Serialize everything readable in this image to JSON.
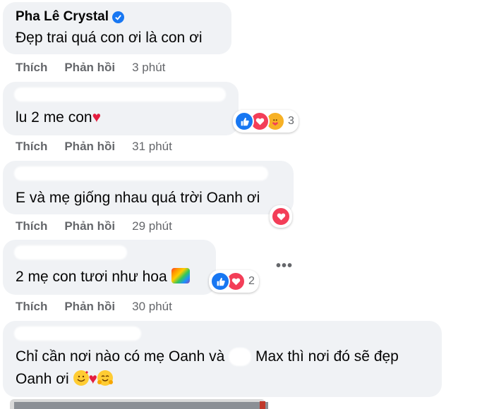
{
  "comments": [
    {
      "author": "Pha Lê Crystal",
      "text": "Đẹp trai quá con ơi là con ơi",
      "actions": {
        "like": "Thích",
        "reply": "Phản hồi",
        "time": "3 phút"
      }
    },
    {
      "text": "lu 2 me con",
      "actions": {
        "like": "Thích",
        "reply": "Phản hồi",
        "time": "31 phút"
      },
      "reactions": {
        "icons": [
          "like-icon",
          "love-icon",
          "care-icon"
        ],
        "count": "3"
      }
    },
    {
      "text": "E và mẹ giống nhau quá trời Oanh ơi",
      "actions": {
        "like": "Thích",
        "reply": "Phản hồi",
        "time": "29 phút"
      },
      "reactions": {
        "icons": [
          "love-icon"
        ]
      }
    },
    {
      "text": "2 mẹ con tươi như hoa",
      "actions": {
        "like": "Thích",
        "reply": "Phản hồi",
        "time": "30 phút"
      },
      "reactions": {
        "icons": [
          "like-icon",
          "love-icon"
        ],
        "count": "2"
      }
    },
    {
      "text_part1": "Chỉ cần nơi nào có mẹ Oanh và",
      "text_part2": "Max thì nơi đó sẽ đẹp",
      "text_line2": "Oanh ơi"
    }
  ],
  "colors": {
    "bubble": "#f0f2f5",
    "like": "#1877f2",
    "love": "#f33e58",
    "muted_text": "#65676b"
  }
}
